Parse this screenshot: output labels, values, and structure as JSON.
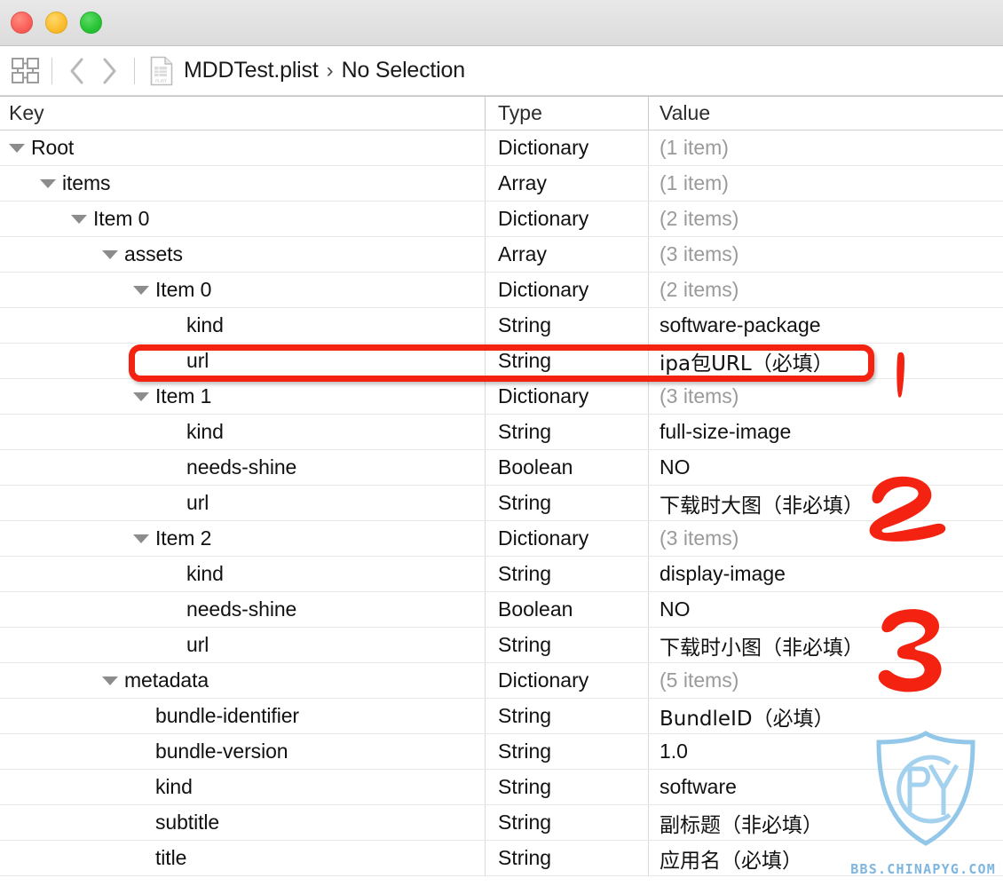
{
  "window": {
    "traffic_lights": [
      {
        "name": "close",
        "color": "#f9615a"
      },
      {
        "name": "minimize",
        "color": "#fbbd2e"
      },
      {
        "name": "maximize",
        "color": "#28c436"
      }
    ]
  },
  "toolbar": {
    "editor_selector_icon": "grid-icon",
    "back_icon": "chevron-left-icon",
    "forward_icon": "chevron-right-icon",
    "file_icon": "plist-document-icon",
    "breadcrumb": [
      {
        "label": "MDDTest.plist"
      },
      {
        "label": "No Selection"
      }
    ],
    "breadcrumb_separator": "›"
  },
  "table": {
    "columns": [
      {
        "id": "key",
        "label": "Key"
      },
      {
        "id": "type",
        "label": "Type"
      },
      {
        "id": "value",
        "label": "Value"
      }
    ],
    "rows": [
      {
        "depth": 0,
        "expanded": true,
        "key": "Root",
        "type": "Dictionary",
        "value": "(1 item)",
        "muted": true
      },
      {
        "depth": 1,
        "expanded": true,
        "key": "items",
        "type": "Array",
        "value": "(1 item)",
        "muted": true
      },
      {
        "depth": 2,
        "expanded": true,
        "key": "Item 0",
        "type": "Dictionary",
        "value": "(2 items)",
        "muted": true
      },
      {
        "depth": 3,
        "expanded": true,
        "key": "assets",
        "type": "Array",
        "value": "(3 items)",
        "muted": true
      },
      {
        "depth": 4,
        "expanded": true,
        "key": "Item 0",
        "type": "Dictionary",
        "value": "(2 items)",
        "muted": true
      },
      {
        "depth": 5,
        "expanded": false,
        "key": "kind",
        "type": "String",
        "value": "software-package",
        "muted": false
      },
      {
        "depth": 5,
        "expanded": false,
        "key": "url",
        "type": "String",
        "value": "ipa包URL（必填）",
        "muted": false,
        "cjk": true,
        "highlighted": true
      },
      {
        "depth": 4,
        "expanded": true,
        "key": "Item 1",
        "type": "Dictionary",
        "value": "(3 items)",
        "muted": true
      },
      {
        "depth": 5,
        "expanded": false,
        "key": "kind",
        "type": "String",
        "value": "full-size-image",
        "muted": false
      },
      {
        "depth": 5,
        "expanded": false,
        "key": "needs-shine",
        "type": "Boolean",
        "value": "NO",
        "muted": false
      },
      {
        "depth": 5,
        "expanded": false,
        "key": "url",
        "type": "String",
        "value": "下载时大图（非必填）",
        "muted": false,
        "cjk": true
      },
      {
        "depth": 4,
        "expanded": true,
        "key": "Item 2",
        "type": "Dictionary",
        "value": "(3 items)",
        "muted": true
      },
      {
        "depth": 5,
        "expanded": false,
        "key": "kind",
        "type": "String",
        "value": "display-image",
        "muted": false
      },
      {
        "depth": 5,
        "expanded": false,
        "key": "needs-shine",
        "type": "Boolean",
        "value": "NO",
        "muted": false
      },
      {
        "depth": 5,
        "expanded": false,
        "key": "url",
        "type": "String",
        "value": "下载时小图（非必填）",
        "muted": false,
        "cjk": true
      },
      {
        "depth": 3,
        "expanded": true,
        "key": "metadata",
        "type": "Dictionary",
        "value": "(5 items)",
        "muted": true
      },
      {
        "depth": 4,
        "expanded": false,
        "key": "bundle-identifier",
        "type": "String",
        "value": "BundleID（必填）",
        "muted": false,
        "cjk": true
      },
      {
        "depth": 4,
        "expanded": false,
        "key": "bundle-version",
        "type": "String",
        "value": "1.0",
        "muted": false
      },
      {
        "depth": 4,
        "expanded": false,
        "key": "kind",
        "type": "String",
        "value": "software",
        "muted": false
      },
      {
        "depth": 4,
        "expanded": false,
        "key": "subtitle",
        "type": "String",
        "value": "副标题（非必填）",
        "muted": false,
        "cjk": true
      },
      {
        "depth": 4,
        "expanded": false,
        "key": "title",
        "type": "String",
        "value": "应用名（必填）",
        "muted": false,
        "cjk": true
      }
    ]
  },
  "annotations": {
    "color": "#f42211",
    "marks": [
      {
        "label": "1",
        "target_row": "url-ipa-package"
      },
      {
        "label": "2",
        "target_row": "url-full-size-image"
      },
      {
        "label": "3",
        "target_row": "url-display-image"
      }
    ]
  },
  "watermark": {
    "letters": [
      "C",
      "P",
      "Y"
    ],
    "site": "BBS.CHINAPYG.COM",
    "color": "#7fb6e0"
  }
}
